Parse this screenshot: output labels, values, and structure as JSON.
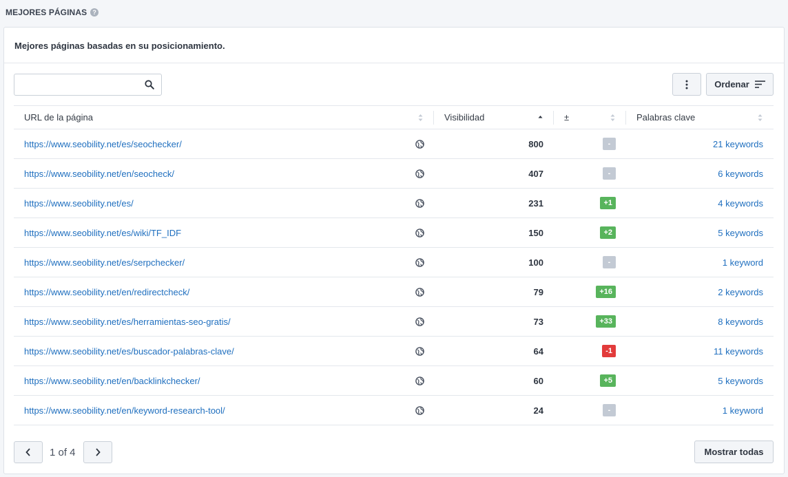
{
  "section": {
    "title": "MEJORES PÁGINAS",
    "help_icon": "question-circle-icon"
  },
  "card": {
    "header": "Mejores páginas basadas en su posicionamiento."
  },
  "search": {
    "value": "",
    "placeholder": ""
  },
  "toolbar": {
    "more_icon": "vertical-dots-icon",
    "sort_label": "Ordenar",
    "sort_icon": "sort-lines-icon"
  },
  "table": {
    "columns": [
      "URL de la página",
      "Visibilidad",
      "±",
      "Palabras clave"
    ],
    "sorted_column": "Visibilidad",
    "rows": [
      {
        "url": "https://www.seobility.net/es/seochecker/",
        "visibility": "800",
        "change": "-",
        "change_type": "neutral",
        "keywords": "21 keywords"
      },
      {
        "url": "https://www.seobility.net/en/seocheck/",
        "visibility": "407",
        "change": "-",
        "change_type": "neutral",
        "keywords": "6 keywords"
      },
      {
        "url": "https://www.seobility.net/es/",
        "visibility": "231",
        "change": "+1",
        "change_type": "pos",
        "keywords": "4 keywords"
      },
      {
        "url": "https://www.seobility.net/es/wiki/TF_IDF",
        "visibility": "150",
        "change": "+2",
        "change_type": "pos",
        "keywords": "5 keywords"
      },
      {
        "url": "https://www.seobility.net/es/serpchecker/",
        "visibility": "100",
        "change": "-",
        "change_type": "neutral",
        "keywords": "1 keyword"
      },
      {
        "url": "https://www.seobility.net/en/redirectcheck/",
        "visibility": "79",
        "change": "+16",
        "change_type": "pos",
        "keywords": "2 keywords"
      },
      {
        "url": "https://www.seobility.net/es/herramientas-seo-gratis/",
        "visibility": "73",
        "change": "+33",
        "change_type": "pos",
        "keywords": "8 keywords"
      },
      {
        "url": "https://www.seobility.net/es/buscador-palabras-clave/",
        "visibility": "64",
        "change": "-1",
        "change_type": "neg",
        "keywords": "11 keywords"
      },
      {
        "url": "https://www.seobility.net/en/backlinkchecker/",
        "visibility": "60",
        "change": "+5",
        "change_type": "pos",
        "keywords": "5 keywords"
      },
      {
        "url": "https://www.seobility.net/en/keyword-research-tool/",
        "visibility": "24",
        "change": "-",
        "change_type": "neutral",
        "keywords": "1 keyword"
      }
    ]
  },
  "pagination": {
    "info": "1 of 4",
    "show_all_label": "Mostrar todas"
  },
  "colors": {
    "link": "#1f6fbf",
    "positive": "#58b45c",
    "negative": "#e23b3b",
    "neutral": "#c3cad4"
  }
}
